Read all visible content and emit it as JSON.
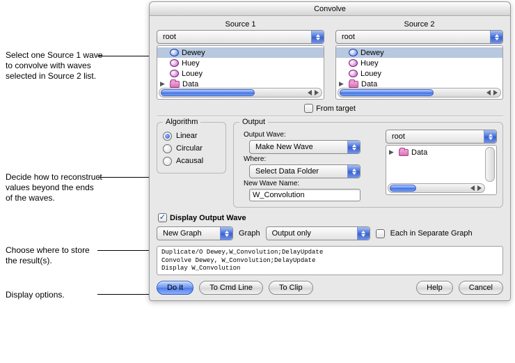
{
  "dialog": {
    "title": "Convolve"
  },
  "annotations": {
    "a1": "Select one Source 1 wave to convolve with waves selected in Source 2 list.",
    "a2": "Decide how to reconstruct values beyond the ends of the waves.",
    "a3": "Choose where to store the result(s).",
    "a4": "Display options."
  },
  "source1": {
    "title": "Source 1",
    "folder": "root",
    "items": [
      "Dewey",
      "Huey",
      "Louey",
      "Data"
    ],
    "selected_index": 0
  },
  "source2": {
    "title": "Source 2",
    "folder": "root",
    "items": [
      "Dewey",
      "Huey",
      "Louey",
      "Data"
    ],
    "selected_index": 0
  },
  "from_target": {
    "label": "From target",
    "checked": false
  },
  "algorithm": {
    "legend": "Algorithm",
    "options": [
      "Linear",
      "Circular",
      "Acausal"
    ],
    "selected_index": 0
  },
  "output": {
    "legend": "Output",
    "output_wave_label": "Output Wave:",
    "output_wave_value": "Make New Wave",
    "where_label": "Where:",
    "where_value": "Select Data Folder",
    "new_wave_name_label": "New Wave Name:",
    "new_wave_name_value": "W_Convolution",
    "dest_folder": "root",
    "dest_tree": [
      "Data"
    ]
  },
  "display": {
    "checkbox_label": "Display Output Wave",
    "checkbox_checked": true,
    "target_value": "New Graph",
    "target_suffix": "Graph",
    "content_value": "Output only",
    "separate_label": "Each in Separate Graph",
    "separate_checked": false
  },
  "cmd_preview": "Duplicate/O Dewey,W_Convolution;DelayUpdate\nConvolve Dewey, W_Convolution;DelayUpdate\nDisplay W_Convolution",
  "buttons": {
    "doit": "Do It",
    "tocmd": "To Cmd Line",
    "toclip": "To Clip",
    "help": "Help",
    "cancel": "Cancel"
  }
}
